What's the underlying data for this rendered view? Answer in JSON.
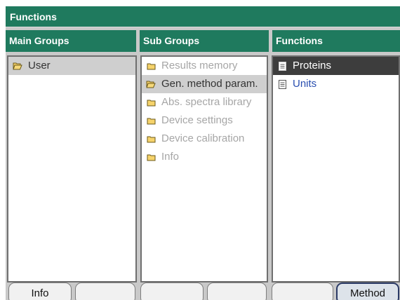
{
  "window": {
    "title": "Functions"
  },
  "columns": {
    "main_groups": "Main Groups",
    "sub_groups": "Sub Groups",
    "functions": "Functions"
  },
  "main_groups": [
    {
      "label": "User",
      "icon": "folder-open-icon",
      "state": "selected"
    }
  ],
  "sub_groups": [
    {
      "label": "Results memory",
      "icon": "folder-icon",
      "state": "disabled"
    },
    {
      "label": "Gen. method param.",
      "icon": "folder-open-icon",
      "state": "selected"
    },
    {
      "label": "Abs. spectra library",
      "icon": "folder-icon",
      "state": "disabled"
    },
    {
      "label": "Device settings",
      "icon": "folder-icon",
      "state": "disabled"
    },
    {
      "label": "Device calibration",
      "icon": "folder-icon",
      "state": "disabled"
    },
    {
      "label": "Info",
      "icon": "folder-icon",
      "state": "disabled"
    }
  ],
  "functions": [
    {
      "label": "Proteins",
      "icon": "document-icon",
      "state": "highlighted"
    },
    {
      "label": "Units",
      "icon": "document-icon",
      "state": "link"
    }
  ],
  "softkeys": [
    "Info",
    "",
    "",
    "",
    "",
    "Method"
  ],
  "colors": {
    "header": "#1f7a5e",
    "selection_dark": "#3d3d3d",
    "selection_light": "#cfcfcf",
    "link": "#2a4fb0",
    "disabled_text": "#a6a6a6"
  }
}
